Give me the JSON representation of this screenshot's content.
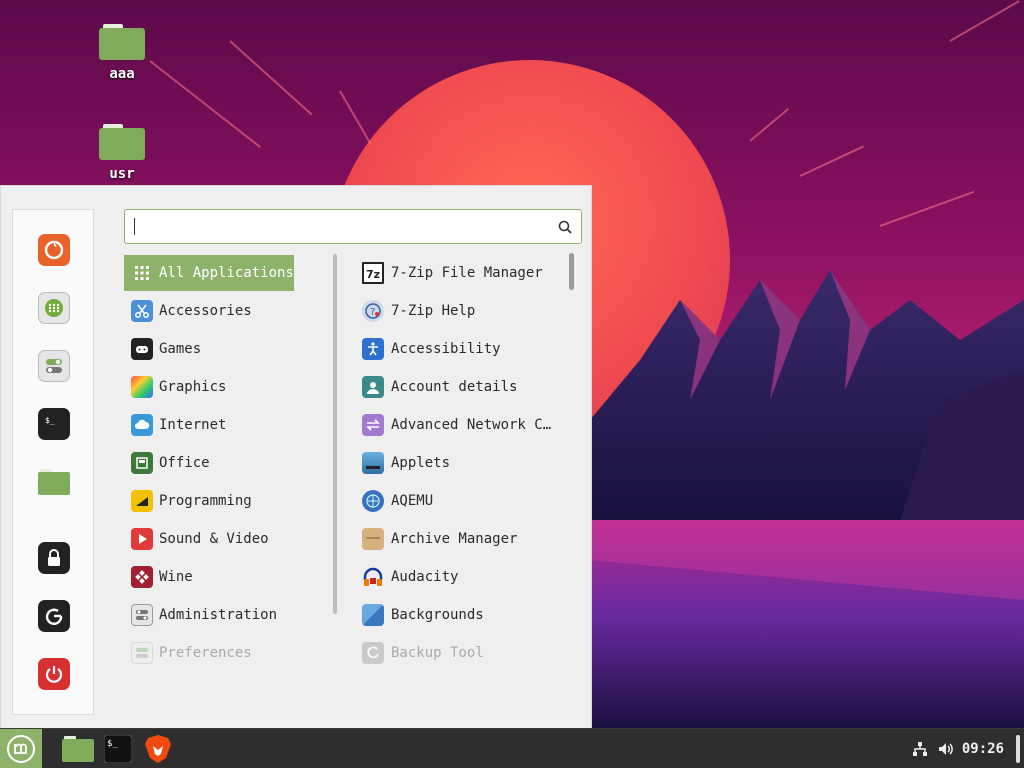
{
  "desktop": {
    "icons": [
      {
        "label": "aaa"
      },
      {
        "label": "usr"
      }
    ]
  },
  "menu": {
    "search": {
      "value": "",
      "placeholder": ""
    },
    "favorites": [
      {
        "name": "firefox-icon"
      },
      {
        "name": "software-manager-icon"
      },
      {
        "name": "settings-icon"
      },
      {
        "name": "terminal-icon"
      },
      {
        "name": "files-icon"
      },
      {
        "name": "lock-screen-icon"
      },
      {
        "name": "logout-icon"
      },
      {
        "name": "shutdown-icon"
      }
    ],
    "categories": [
      {
        "label": "All Applications",
        "selected": true
      },
      {
        "label": "Accessories"
      },
      {
        "label": "Games"
      },
      {
        "label": "Graphics"
      },
      {
        "label": "Internet"
      },
      {
        "label": "Office"
      },
      {
        "label": "Programming"
      },
      {
        "label": "Sound & Video"
      },
      {
        "label": "Wine"
      },
      {
        "label": "Administration"
      },
      {
        "label": "Preferences"
      }
    ],
    "apps": [
      {
        "label": "7-Zip File Manager"
      },
      {
        "label": "7-Zip Help"
      },
      {
        "label": "Accessibility"
      },
      {
        "label": "Account details"
      },
      {
        "label": "Advanced Network C…"
      },
      {
        "label": "Applets"
      },
      {
        "label": "AQEMU"
      },
      {
        "label": "Archive Manager"
      },
      {
        "label": "Audacity"
      },
      {
        "label": "Backgrounds"
      },
      {
        "label": "Backup Tool"
      }
    ]
  },
  "taskbar": {
    "clock": "09:26"
  },
  "colors": {
    "accent": "#8fb26a",
    "taskbar": "#2e2e2e"
  }
}
